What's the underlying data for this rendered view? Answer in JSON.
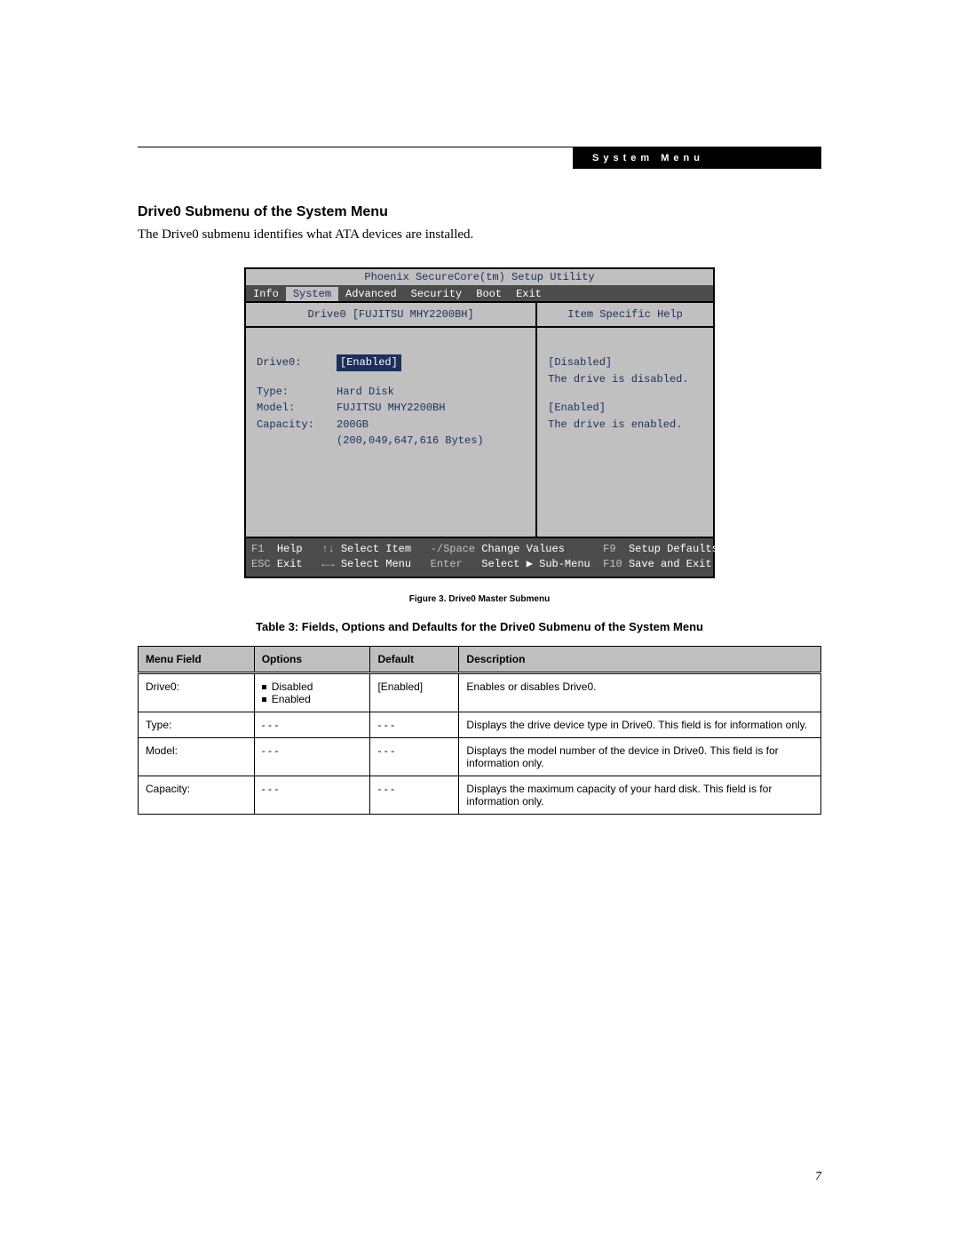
{
  "header": {
    "tag": "System Menu"
  },
  "section": {
    "title": "Drive0 Submenu of the System Menu",
    "intro": "The Drive0 submenu identifies what ATA devices are installed."
  },
  "bios": {
    "title": "Phoenix SecureCore(tm) Setup Utility",
    "menu": [
      "Info",
      "System",
      "Advanced",
      "Security",
      "Boot",
      "Exit"
    ],
    "selected_menu": "System",
    "left_title": "Drive0 [FUJITSU MHY2200BH]",
    "right_title": "Item Specific Help",
    "fields": {
      "drive0_label": "Drive0:",
      "drive0_value": "[Enabled]",
      "type_label": "Type:",
      "type_value": "Hard Disk",
      "model_label": "Model:",
      "model_value": "FUJITSU MHY2200BH",
      "capacity_label": "Capacity:",
      "capacity_value": "200GB",
      "capacity_bytes": "(200,049,647,616 Bytes)"
    },
    "help": {
      "disabled_title": "[Disabled]",
      "disabled_text": "The drive is disabled.",
      "enabled_title": "[Enabled]",
      "enabled_text": "The drive is enabled."
    },
    "footer": {
      "f1": "F1",
      "help": "Help",
      "updown": "↑↓",
      "select_item": "Select Item",
      "minus_space": "-/Space",
      "change_values": "Change Values",
      "f9": "F9",
      "setup_defaults": "Setup Defaults",
      "esc": "ESC",
      "exit": "Exit",
      "leftright": "←→",
      "select_menu": "Select Menu",
      "enter": "Enter",
      "select_submenu": "Select ▶ Sub-Menu",
      "f10": "F10",
      "save_exit": "Save and Exit"
    }
  },
  "figure_caption": "Figure 3.  Drive0 Master Submenu",
  "table_caption": "Table 3: Fields, Options and Defaults for the Drive0 Submenu of the System Menu",
  "table": {
    "headers": [
      "Menu Field",
      "Options",
      "Default",
      "Description"
    ],
    "rows": [
      {
        "field": "Drive0:",
        "options": [
          "Disabled",
          "Enabled"
        ],
        "default": "[Enabled]",
        "desc": "Enables or disables Drive0."
      },
      {
        "field": "Type:",
        "options_text": "- - -",
        "default": "- - -",
        "desc": "Displays the drive device type in Drive0. This field is for information only."
      },
      {
        "field": "Model:",
        "options_text": "- - -",
        "default": "- - -",
        "desc": "Displays the model number of the device in Drive0. This field is for information only."
      },
      {
        "field": "Capacity:",
        "options_text": "- - -",
        "default": "- - -",
        "desc": "Displays the maximum capacity of your hard disk. This field is for information only."
      }
    ]
  },
  "page_number": "7"
}
